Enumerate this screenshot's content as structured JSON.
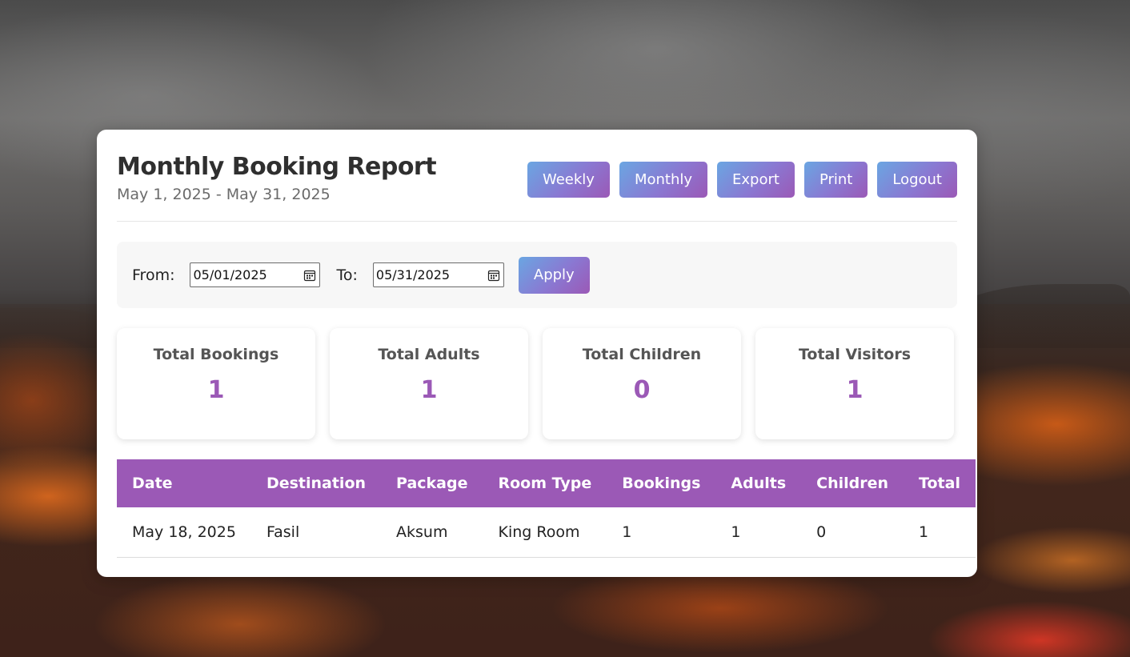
{
  "report": {
    "title": "Monthly Booking Report",
    "subtitle": "May 1, 2025 - May 31, 2025"
  },
  "actions": {
    "weekly": "Weekly",
    "monthly": "Monthly",
    "export": "Export",
    "print": "Print",
    "logout": "Logout"
  },
  "filter": {
    "from_label": "From:",
    "from_value": "05/01/2025",
    "to_label": "To:",
    "to_value": "05/31/2025",
    "apply": "Apply"
  },
  "stats": [
    {
      "label": "Total Bookings",
      "value": "1"
    },
    {
      "label": "Total Adults",
      "value": "1"
    },
    {
      "label": "Total Children",
      "value": "0"
    },
    {
      "label": "Total Visitors",
      "value": "1"
    }
  ],
  "table": {
    "headers": [
      "Date",
      "Destination",
      "Package",
      "Room Type",
      "Bookings",
      "Adults",
      "Children",
      "Total"
    ],
    "rows": [
      [
        "May 18, 2025",
        "Fasil",
        "Aksum",
        "King Room",
        "1",
        "1",
        "0",
        "1"
      ]
    ]
  },
  "colors": {
    "accent": "#9b59b6",
    "gradient_start": "#6aa6e2"
  }
}
